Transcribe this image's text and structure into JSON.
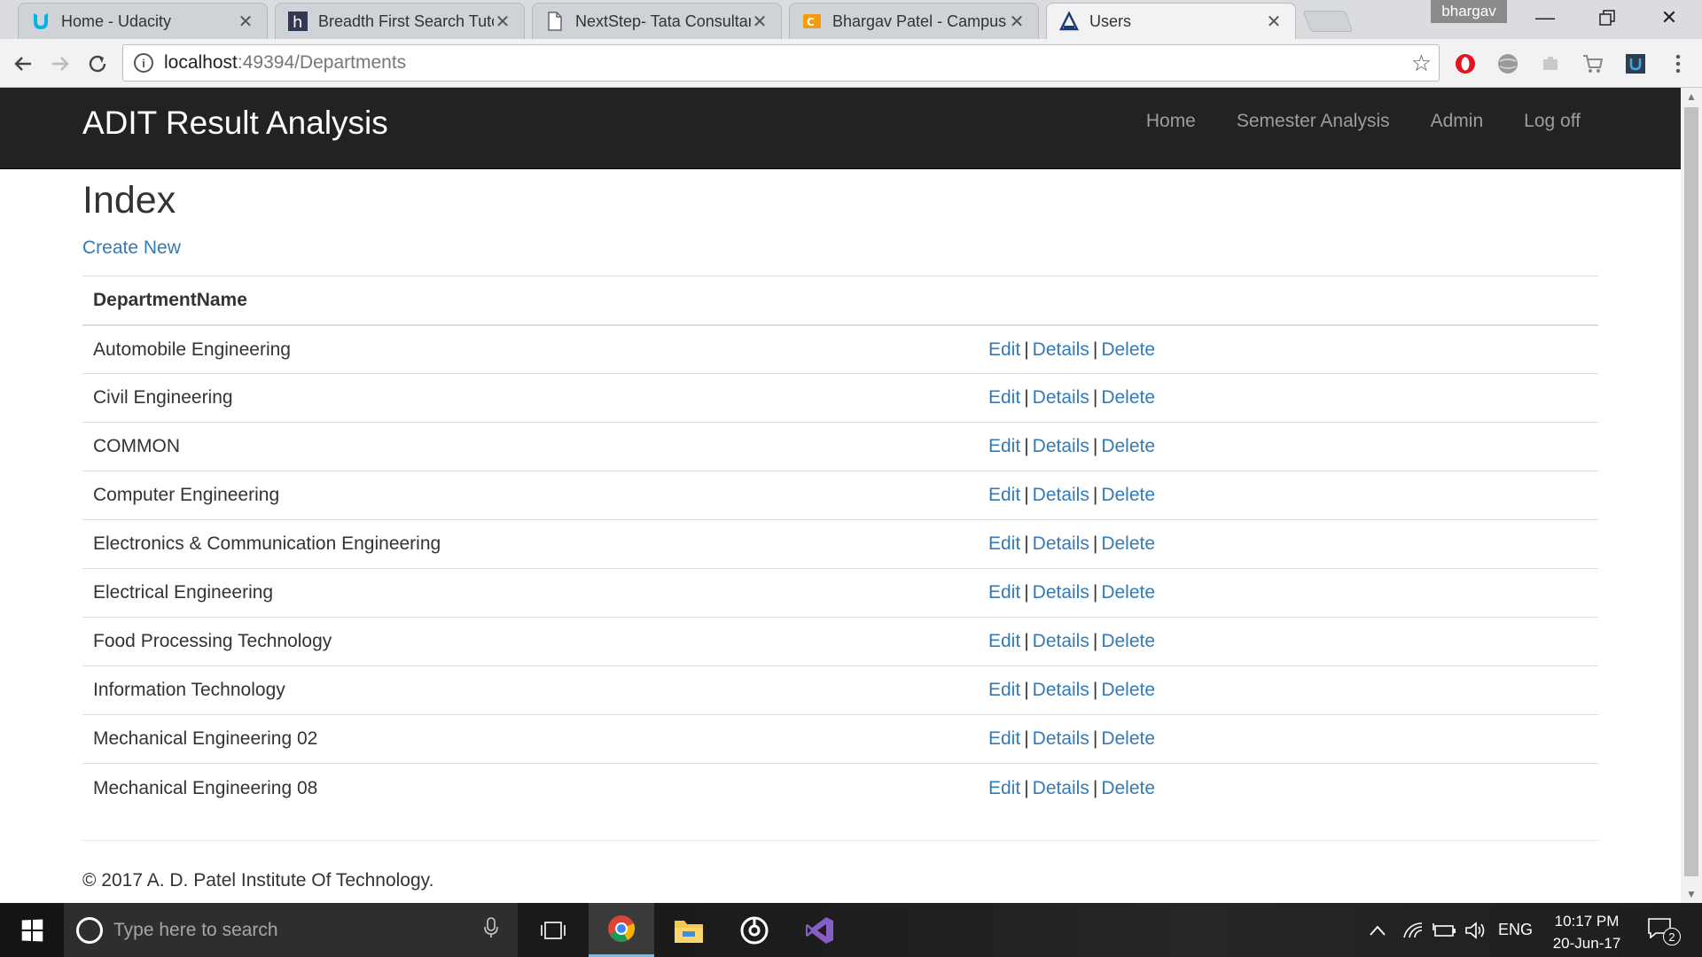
{
  "browser": {
    "tabs": [
      {
        "title": "Home - Udacity",
        "icon": "udacity-icon",
        "active": false
      },
      {
        "title": "Breadth First Search Tuto",
        "icon": "hackerearth-icon",
        "active": false
      },
      {
        "title": "NextStep- Tata Consultar",
        "icon": "page-icon",
        "active": false
      },
      {
        "title": "Bhargav Patel - Campus",
        "icon": "campus-icon",
        "active": false
      },
      {
        "title": "Users",
        "icon": "adit-icon",
        "active": true
      }
    ],
    "profile_name": "bhargav",
    "address": {
      "host": "localhost",
      "rest": ":49394/Departments"
    },
    "extensions": [
      "opera-icon",
      "globe-icon",
      "puzzle-icon",
      "cart-icon",
      "shield-ext-icon",
      "menu-dots-icon"
    ]
  },
  "site": {
    "brand": "ADIT Result Analysis",
    "nav": [
      {
        "label": "Home"
      },
      {
        "label": "Semester Analysis"
      },
      {
        "label": "Admin"
      },
      {
        "label": "Log off"
      }
    ],
    "page_title": "Index",
    "create_link": "Create New",
    "table": {
      "header": "DepartmentName",
      "actions": {
        "edit": "Edit",
        "details": "Details",
        "delete": "Delete",
        "separator": "|"
      },
      "rows": [
        "Automobile Engineering",
        "Civil Engineering",
        "COMMON",
        "Computer Engineering",
        "Electronics & Communication Engineering",
        "Electrical Engineering",
        "Food Processing Technology",
        "Information Technology",
        "Mechanical Engineering 02",
        "Mechanical Engineering 08"
      ]
    },
    "footer": "© 2017 A. D. Patel Institute Of Technology."
  },
  "taskbar": {
    "search_placeholder": "Type here to search",
    "language": "ENG",
    "time": "10:17 PM",
    "date": "20-Jun-17",
    "notification_count": "2"
  },
  "colors": {
    "navbar_bg": "#222222",
    "link": "#337ab7",
    "nav_link": "#9d9d9d"
  }
}
